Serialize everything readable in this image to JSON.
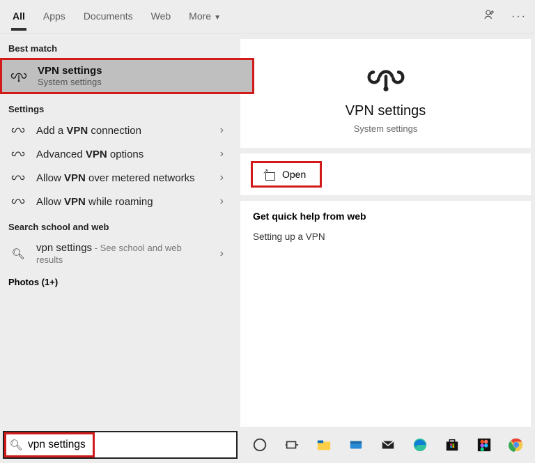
{
  "tabs": {
    "all": "All",
    "apps": "Apps",
    "documents": "Documents",
    "web": "Web",
    "more": "More"
  },
  "left": {
    "best_match_hdr": "Best match",
    "best_item": {
      "title": "VPN settings",
      "sub": "System settings"
    },
    "settings_hdr": "Settings",
    "settings_items": [
      {
        "pre": "Add a ",
        "bold": "VPN",
        "post": " connection"
      },
      {
        "pre": "Advanced ",
        "bold": "VPN",
        "post": " options"
      },
      {
        "pre": "Allow ",
        "bold": "VPN",
        "post": " over metered networks"
      },
      {
        "pre": "Allow ",
        "bold": "VPN",
        "post": " while roaming"
      }
    ],
    "search_sw_hdr": "Search school and web",
    "search_sw_item": {
      "label": "vpn settings",
      "suffix": " - See school and web results"
    },
    "photos_hdr": "Photos (1+)"
  },
  "right": {
    "title": "VPN settings",
    "sub": "System settings",
    "open_label": "Open",
    "help_hdr": "Get quick help from web",
    "help_link": "Setting up a VPN"
  },
  "searchbar": {
    "value": "vpn settings"
  }
}
